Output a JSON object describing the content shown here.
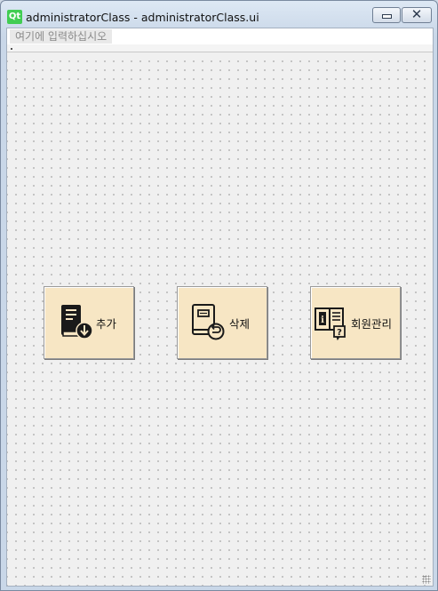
{
  "window": {
    "logo_text": "Qt",
    "title": "administratorClass - administratorClass.ui",
    "close_glyph": "✕"
  },
  "menubar": {
    "placeholder": "여기에 입력하십시오"
  },
  "buttons": [
    {
      "label": "추가",
      "icon": "book-download-icon"
    },
    {
      "label": "삭제",
      "icon": "book-return-icon"
    },
    {
      "label": "회원관리",
      "icon": "book-info-question-icon"
    }
  ],
  "colors": {
    "button_bg": "#f7e6c4",
    "canvas_bg": "#f0f0f0",
    "qt_green": "#41cd52"
  }
}
